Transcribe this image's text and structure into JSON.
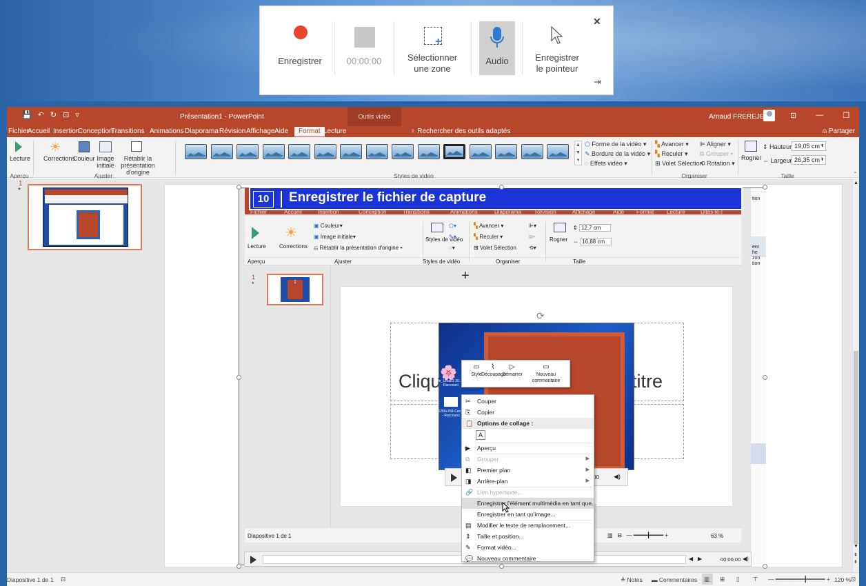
{
  "recorder": {
    "record_label": "Enregistrer",
    "timer": "00:00:00",
    "select_area_label": "Sélectionner une zone",
    "audio_label": "Audio",
    "record_pointer_label": "Enregistrer le pointeur",
    "close_glyph": "✕",
    "pin_glyph": "⇥"
  },
  "titlebar": {
    "title": "Présentation1 - PowerPoint",
    "context_tab": "Outils vidéo",
    "user": "Arnaud FREREJEAN",
    "qat": [
      "💾",
      "↶",
      "↻",
      "⊡",
      "▿"
    ],
    "win_buttons": [
      "⊡",
      "—",
      "❐",
      "✕"
    ]
  },
  "tabs": [
    "Fichier",
    "Accueil",
    "Insertion",
    "Conception",
    "Transitions",
    "Animations",
    "Diaporama",
    "Révision",
    "Affichage",
    "Aide",
    "Format",
    "Lecture"
  ],
  "tell_me": "Rechercher des outils adaptés",
  "share": "Partager",
  "ribbon": {
    "play": "Lecture",
    "corrections": "Corrections",
    "color": "Couleur",
    "image_initiale": "Image initiale",
    "reset": "Rétablir la présentation d'origine",
    "group_apercu": "Aperçu",
    "group_ajuster": "Ajuster",
    "group_styles": "Styles de vidéo",
    "group_organiser": "Organiser",
    "group_taille": "Taille",
    "shape": "Forme de la vidéo",
    "border": "Bordure de la vidéo",
    "effects": "Effets vidéo",
    "forward": "Avancer",
    "backward": "Reculer",
    "selection_pane": "Volet Sélection",
    "align": "Aligner",
    "group": "Grouper",
    "rotate": "Rotation",
    "crop": "Rogner",
    "height_label": "Hauteur :",
    "height_value": "19,05 cm",
    "width_label": "Largeur :",
    "width_value": "26,35 cm"
  },
  "thumbs": {
    "number": "1",
    "star": "*"
  },
  "inner": {
    "banner_num": "10",
    "banner_title": "Enregistrer le fichier de capture",
    "tabs": [
      "Fichier",
      "Accueil",
      "Insertion",
      "Conception",
      "Transitions",
      "Animations",
      "Diaporama",
      "Révision",
      "Affichage",
      "Aide",
      "Format",
      "Lecture",
      "Dites-le-I",
      "Partager"
    ],
    "play": "Lecture",
    "corrections": "Corrections",
    "color": "Couleur",
    "image_initiale": "Image initiale",
    "reset": "Rétablir la présentation d'origine",
    "styles": "Styles de vidéo",
    "forward": "Avancer",
    "backward": "Reculer",
    "selection_pane": "Volet Sélection",
    "crop": "Rogner",
    "height": "12,7 cm",
    "width": "16,88 cm",
    "group_apercu": "Aperçu",
    "group_ajuster": "Ajuster",
    "group_styles": "Styles de vidéo",
    "group_organiser": "Organiser",
    "group_taille": "Taille",
    "slide_num": "1",
    "slide_title_left": "Cliqu",
    "slide_title_right": "titre",
    "status_slide": "Diapositive 1 de 1",
    "zoom": "63 %",
    "video_time": "00",
    "outer_video_time": "00:00,00",
    "desktop_icon1": "Ar_Ultra01-20... - Raccourci",
    "desktop_icon2": "1256x768-Cen... - Raccourci",
    "right_panel": [
      "tion",
      "ent",
      "he",
      "zon",
      "tion"
    ]
  },
  "mini_toolbar": [
    "Style",
    "Découpage",
    "Démarrer",
    "Nouveau commentaire"
  ],
  "context_menu": [
    {
      "label": "Couper",
      "icon": "✂",
      "disabled": false
    },
    {
      "label": "Copier",
      "icon": "⎘",
      "disabled": false
    },
    {
      "label": "Options de collage :",
      "icon": "📋",
      "disabled": false,
      "header": true
    },
    {
      "label": "Aperçu",
      "icon": "▶",
      "disabled": false
    },
    {
      "label": "Grouper",
      "icon": "⧉",
      "disabled": true,
      "arrow": true
    },
    {
      "label": "Premier plan",
      "icon": "◧",
      "disabled": false,
      "arrow": true
    },
    {
      "label": "Arrière-plan",
      "icon": "◨",
      "disabled": false,
      "arrow": true
    },
    {
      "label": "Lien hypertexte...",
      "icon": "🔗",
      "disabled": true
    },
    {
      "label": "Enregistrer l'élément multimédia en tant que...",
      "icon": "",
      "disabled": false,
      "hover": true
    },
    {
      "label": "Enregistrer en tant qu'image...",
      "icon": "",
      "disabled": false
    },
    {
      "label": "Modifier le texte de remplacement...",
      "icon": "▤",
      "disabled": false
    },
    {
      "label": "Taille et position...",
      "icon": "⇕",
      "disabled": false
    },
    {
      "label": "Format vidéo...",
      "icon": "✎",
      "disabled": false
    },
    {
      "label": "Nouveau commentaire",
      "icon": "💬",
      "disabled": false
    }
  ],
  "status": {
    "slide": "Diapositive 1 de 1",
    "notes": "Notes",
    "comments": "Commentaires",
    "zoom": "120 %"
  }
}
